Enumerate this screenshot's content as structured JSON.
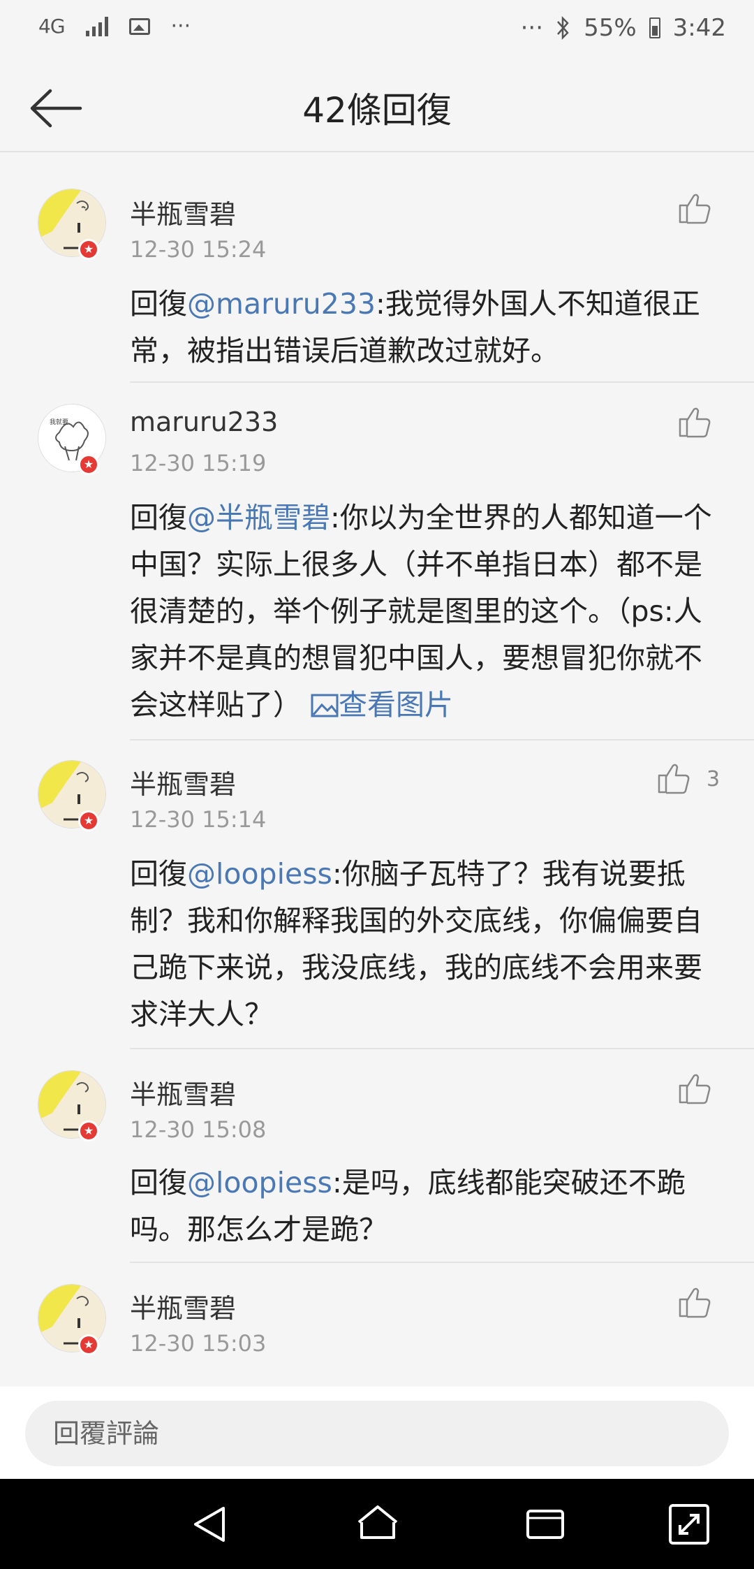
{
  "status_bar": {
    "network": "4G",
    "dots_left": "···",
    "dots_right": "···",
    "battery": "55%",
    "time": "3:42"
  },
  "header": {
    "title": "42條回復"
  },
  "comments": [
    {
      "name": "半瓶雪碧",
      "time": "12-30 15:24",
      "reply_prefix": "回復",
      "mention": "@maruru233",
      "text": ":我觉得外国人不知道很正常，被指出错误后道歉改过就好。",
      "like_count": ""
    },
    {
      "name": "maruru233",
      "time": "12-30 15:19",
      "reply_prefix": "回復",
      "mention": "@半瓶雪碧",
      "text": ":你以为全世界的人都知道一个中国？实际上很多人（并不单指日本）都不是很清楚的，举个例子就是图里的这个。（ps:人家并不是真的想冒犯中国人，要想冒犯你就不会这样贴了）",
      "image_link": "查看图片",
      "like_count": ""
    },
    {
      "name": "半瓶雪碧",
      "time": "12-30 15:14",
      "reply_prefix": "回復",
      "mention": "@loopiess",
      "text": ":你脑子瓦特了？我有说要抵制？我和你解释我国的外交底线，你偏偏要自己跪下来说，我没底线，我的底线不会用来要求洋大人？",
      "like_count": "3"
    },
    {
      "name": "半瓶雪碧",
      "time": "12-30 15:08",
      "reply_prefix": "回復",
      "mention": "@loopiess",
      "text": ":是吗，底线都能突破还不跪吗。那怎么才是跪？",
      "like_count": ""
    },
    {
      "name": "半瓶雪碧",
      "time": "12-30 15:03",
      "reply_prefix": "",
      "mention": "",
      "text": "",
      "like_count": ""
    }
  ],
  "reply_bar": {
    "placeholder": "回覆評論"
  },
  "colors": {
    "mention": "#4a78b5",
    "background": "#f5f5f5",
    "badge": "#e53935"
  }
}
